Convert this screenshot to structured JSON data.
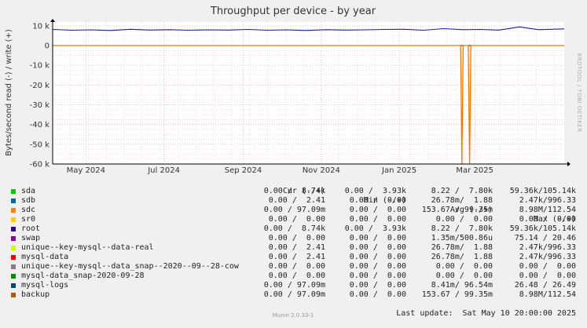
{
  "chart_data": {
    "type": "line",
    "title": "Throughput per device - by year",
    "ylabel": "Bytes/second read (-) / write (+)",
    "side_label": "RRDTOOL / TOBI OETIKER",
    "ylim": [
      -60000,
      12000
    ],
    "y_ticks": [
      {
        "value": 10000,
        "label": "10 k"
      },
      {
        "value": 0,
        "label": "0"
      },
      {
        "value": -10000,
        "label": "-10 k"
      },
      {
        "value": -20000,
        "label": "-20 k"
      },
      {
        "value": -30000,
        "label": "-30 k"
      },
      {
        "value": -40000,
        "label": "-40 k"
      },
      {
        "value": -50000,
        "label": "-50 k"
      },
      {
        "value": -60000,
        "label": "-60 k"
      }
    ],
    "x_range": [
      "2024-04-05",
      "2025-05-10"
    ],
    "x_ticks": [
      {
        "date": "2024-05-01",
        "label": "May 2024"
      },
      {
        "date": "2024-07-01",
        "label": "Jul 2024"
      },
      {
        "date": "2024-09-01",
        "label": "Sep 2024"
      },
      {
        "date": "2024-11-01",
        "label": "Nov 2024"
      },
      {
        "date": "2025-01-01",
        "label": "Jan 2025"
      },
      {
        "date": "2025-03-01",
        "label": "Mar 2025"
      }
    ],
    "series": [
      {
        "name": "root",
        "color": "#1a1aa8",
        "x": [
          "2024-04-05",
          "2024-04-20",
          "2024-05-05",
          "2024-05-20",
          "2024-06-05",
          "2024-06-20",
          "2024-07-05",
          "2024-07-20",
          "2024-08-05",
          "2024-08-20",
          "2024-09-05",
          "2024-09-20",
          "2024-10-05",
          "2024-10-20",
          "2024-11-05",
          "2024-11-20",
          "2024-12-05",
          "2024-12-20",
          "2025-01-05",
          "2025-01-20",
          "2025-02-05",
          "2025-02-20",
          "2025-03-05",
          "2025-03-20",
          "2025-04-05",
          "2025-04-20",
          "2025-05-10"
        ],
        "y": [
          8200,
          7800,
          8000,
          7700,
          8300,
          7900,
          8100,
          7800,
          8000,
          7900,
          8200,
          7800,
          8000,
          7700,
          8100,
          7900,
          8000,
          8200,
          8300,
          7800,
          8600,
          8100,
          8200,
          7900,
          9500,
          8100,
          8500
        ]
      },
      {
        "name": "sdc",
        "color": "#ee7a00",
        "x": [
          "2024-04-05",
          "2025-02-18",
          "2025-02-19",
          "2025-02-20",
          "2025-02-24",
          "2025-02-25",
          "2025-02-26",
          "2025-05-10"
        ],
        "y": [
          0,
          0,
          -60000,
          0,
          0,
          -60000,
          0,
          0
        ]
      }
    ],
    "legend": {
      "columns": [
        "Cur (-/+)",
        "Min (-/+)",
        "Avg (-/+)",
        "Max (-/+)"
      ],
      "rows": [
        {
          "name": "sda",
          "color": "#00cc00",
          "cur": "0.00 /  8.74k",
          "min": "0.00 /  3.93k",
          "avg": "8.22 /  7.80k",
          "max": "59.36k/105.14k"
        },
        {
          "name": "sdb",
          "color": "#0066b3",
          "cur": "0.00 /  2.41",
          "min": "0.00 /  0.00",
          "avg": "26.78m/  1.88",
          "max": "2.47k/996.33"
        },
        {
          "name": "sdc",
          "color": "#ff8000",
          "cur": "0.00 / 97.09m",
          "min": "0.00 /  0.00",
          "avg": "153.67 / 99.35m",
          "max": "8.98M/112.54"
        },
        {
          "name": "sr0",
          "color": "#ffcc00",
          "cur": "0.00 /  0.00",
          "min": "0.00 /  0.00",
          "avg": "0.00 /  0.00",
          "max": "0.00 /  0.00"
        },
        {
          "name": "root",
          "color": "#330099",
          "cur": "0.00 /  8.74k",
          "min": "0.00 /  3.93k",
          "avg": "8.22 /  7.80k",
          "max": "59.36k/105.14k"
        },
        {
          "name": "swap",
          "color": "#990099",
          "cur": "0.00 /  0.00",
          "min": "0.00 /  0.00",
          "avg": "1.35m/500.86u",
          "max": "75.14 / 20.46"
        },
        {
          "name": "unique--key-mysql--data-real",
          "color": "#ccff00",
          "cur": "0.00 /  2.41",
          "min": "0.00 /  0.00",
          "avg": "26.78m/  1.88",
          "max": "2.47k/996.33"
        },
        {
          "name": "mysql-data",
          "color": "#ff0000",
          "cur": "0.00 /  2.41",
          "min": "0.00 /  0.00",
          "avg": "26.78m/  1.88",
          "max": "2.47k/996.33"
        },
        {
          "name": "unique--key-mysql--data_snap--2020--09--28-cow",
          "color": "#808080",
          "cur": "0.00 /  0.00",
          "min": "0.00 /  0.00",
          "avg": "0.00 /  0.00",
          "max": "0.00 /  0.00"
        },
        {
          "name": "mysql-data_snap-2020-09-28",
          "color": "#008f00",
          "cur": "0.00 /  0.00",
          "min": "0.00 /  0.00",
          "avg": "0.00 /  0.00",
          "max": "0.00 /  0.00"
        },
        {
          "name": "mysql-logs",
          "color": "#00487d",
          "cur": "0.00 / 97.09m",
          "min": "0.00 /  0.00",
          "avg": "8.41m/ 96.54m",
          "max": "26.48 / 26.49"
        },
        {
          "name": "backup",
          "color": "#b35a00",
          "cur": "0.00 / 97.09m",
          "min": "0.00 /  0.00",
          "avg": "153.67 / 99.35m",
          "max": "8.98M/112.54"
        }
      ],
      "last_update": "Last update:  Sat May 10 20:00:00 2025"
    },
    "footer": "Munin 2.0.33-1"
  }
}
